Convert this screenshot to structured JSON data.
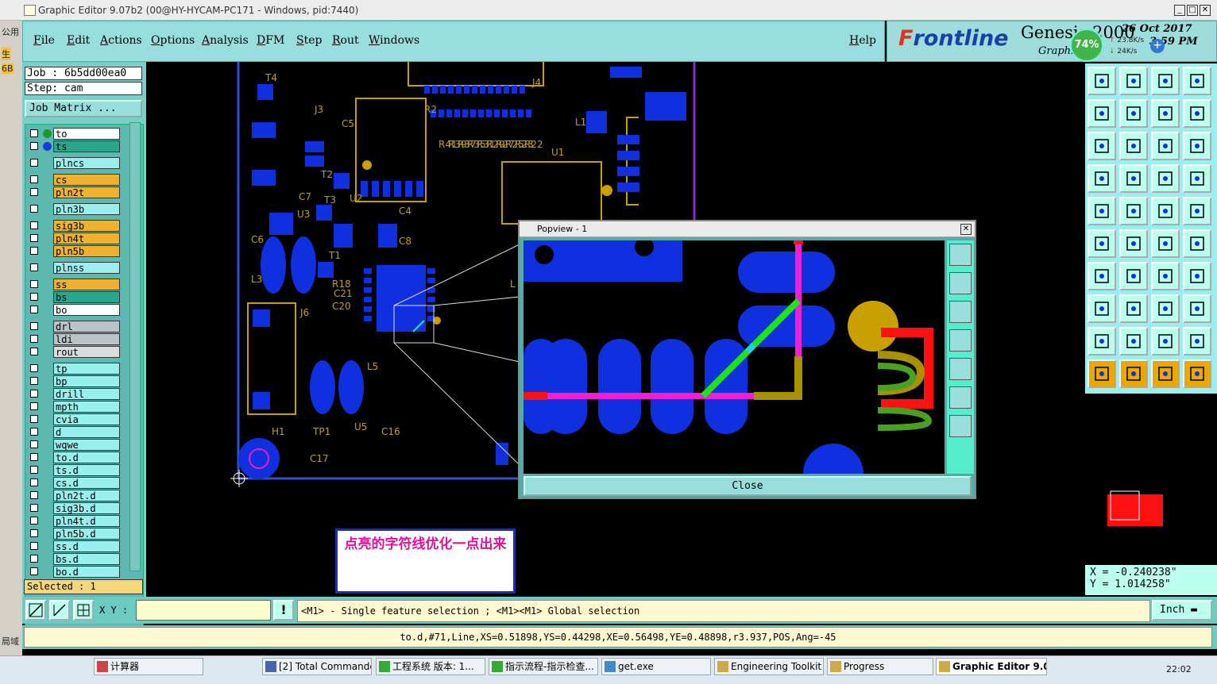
{
  "window": {
    "title": "Graphic Editor 9.07b2 (00@HY-HYCAM-PC171 - Windows, pid:7440)"
  },
  "left_strip": {
    "items": [
      "公用",
      "生",
      "6B",
      "局域"
    ]
  },
  "menu": {
    "items": [
      "File",
      "Edit",
      "Actions",
      "Options",
      "Analysis",
      "DFM",
      "Step",
      "Rout",
      "Windows"
    ],
    "help": "Help"
  },
  "brand": {
    "logo_prefix": "F",
    "logo_rest": "rontline",
    "product": "Genesis 2000",
    "product_sub": "Graphic",
    "date": "26 Oct 2017",
    "time": "3:59 PM"
  },
  "network_widget": {
    "percent": "74%",
    "up": "23.8K/s",
    "down": "24K/s",
    "plus": "+"
  },
  "job": {
    "job_line": "Job : 6b5dd00ea0",
    "step_line": "Step: cam",
    "matrix_button": "Job Matrix ..."
  },
  "layers": [
    {
      "name": "to",
      "color": "white",
      "dot": "#1a9a2a"
    },
    {
      "name": "ts",
      "color": "green",
      "dot": "#1a3ae0"
    },
    {
      "name": "plncs",
      "color": "cyan"
    },
    {
      "name": "cs",
      "color": "orange"
    },
    {
      "name": "pln2t",
      "color": "orange"
    },
    {
      "name": "pln3b",
      "color": "cyan"
    },
    {
      "name": "sig3b",
      "color": "orange"
    },
    {
      "name": "pln4t",
      "color": "orange"
    },
    {
      "name": "pln5b",
      "color": "orange"
    },
    {
      "name": "plnss",
      "color": "cyan"
    },
    {
      "name": "ss",
      "color": "orange"
    },
    {
      "name": "bs",
      "color": "green"
    },
    {
      "name": "bo",
      "color": "white"
    },
    {
      "name": "drl",
      "color": "grey"
    },
    {
      "name": "ldi",
      "color": "grey"
    },
    {
      "name": "rout",
      "color": "lgrey"
    },
    {
      "name": "tp",
      "color": "cyan"
    },
    {
      "name": "bp",
      "color": "cyan"
    },
    {
      "name": "drill",
      "color": "cyan"
    },
    {
      "name": "mpth",
      "color": "cyan"
    },
    {
      "name": "cvia",
      "color": "cyan"
    },
    {
      "name": "d",
      "color": "cyan"
    },
    {
      "name": "wqwe",
      "color": "cyan"
    },
    {
      "name": "to.d",
      "color": "cyan"
    },
    {
      "name": "ts.d",
      "color": "cyan"
    },
    {
      "name": "cs.d",
      "color": "cyan"
    },
    {
      "name": "pln2t.d",
      "color": "cyan"
    },
    {
      "name": "sig3b.d",
      "color": "cyan"
    },
    {
      "name": "pln4t.d",
      "color": "cyan"
    },
    {
      "name": "pln5b.d",
      "color": "cyan"
    },
    {
      "name": "ss.d",
      "color": "cyan"
    },
    {
      "name": "bs.d",
      "color": "cyan"
    },
    {
      "name": "bo.d",
      "color": "cyan"
    }
  ],
  "selected": "Selected : 1",
  "pcb_labels": [
    "T4",
    "J3",
    "C5",
    "R2",
    "J4",
    "L1",
    "U1",
    "T2",
    "U2",
    "C4",
    "R41",
    "R39",
    "R37",
    "R35",
    "R31",
    "R29",
    "R27",
    "R25",
    "R23",
    "R22",
    "C7",
    "T3",
    "U3",
    "C8",
    "C6",
    "T1",
    "L3",
    "R18",
    "C21",
    "C20",
    "J6",
    "L5",
    "H1",
    "TP1",
    "U5",
    "C16",
    "C17",
    "L"
  ],
  "popview": {
    "title": "Popview - 1",
    "close": "Close"
  },
  "note": "点亮的字符线优化一点出来",
  "coords": {
    "x": "X = -0.240238\"",
    "y": "Y =  1.014258\""
  },
  "command": {
    "xy_label": "X Y :",
    "xy_value": "",
    "message": "<M1> - Single feature selection ; <M1><M1> Global selection",
    "units": "Inch"
  },
  "status": "to.d,#71,Line,XS=0.51898,YS=0.44298,XE=0.56498,YE=0.48898,r3.937,POS,Ang=-45",
  "taskbar": {
    "tasks": [
      "计算器",
      "[2] Total Commander...",
      "工程系统  版本: 1...",
      "指示流程-指示检查...",
      "get.exe",
      "Engineering Toolkit 9...",
      "Progress",
      "Graphic Editor 9.0..."
    ],
    "time": "22:02"
  }
}
